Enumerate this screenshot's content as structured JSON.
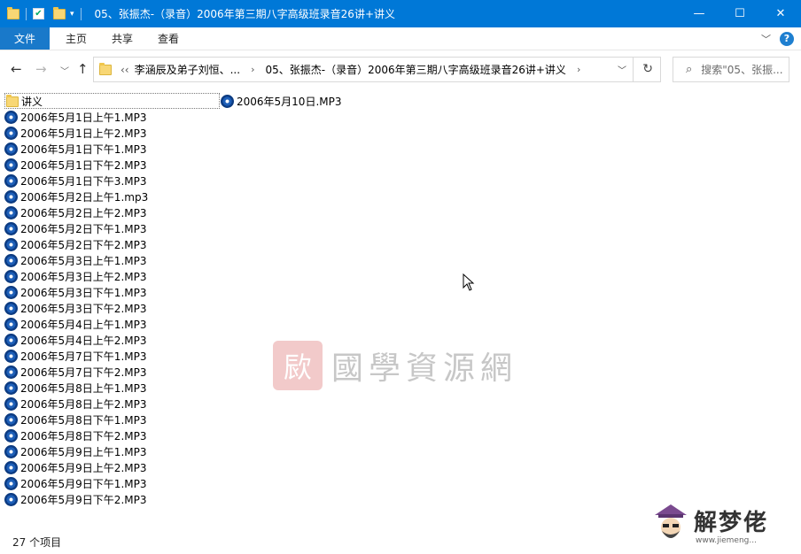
{
  "window": {
    "title": "05、张振杰-（录音）2006年第三期八字高级班录音26讲+讲义",
    "controls": {
      "minimize": "—",
      "maximize": "☐",
      "close": "✕"
    }
  },
  "ribbon": {
    "tabs": [
      "文件",
      "主页",
      "共享",
      "查看"
    ],
    "help": "?"
  },
  "address_bar": {
    "overflow": "‹‹",
    "crumbs": [
      "李涵辰及弟子刘恒、...",
      "05、张振杰-（录音）2006年第三期八字高级班录音26讲+讲义"
    ],
    "separator": "›"
  },
  "search": {
    "placeholder": "搜索\"05、张振..."
  },
  "files": [
    {
      "name": "讲义",
      "type": "folder"
    },
    {
      "name": "2006年5月10日.MP3",
      "type": "mp3"
    },
    {
      "name": "2006年5月1日上午1.MP3",
      "type": "mp3"
    },
    {
      "name": "2006年5月1日上午2.MP3",
      "type": "mp3"
    },
    {
      "name": "2006年5月1日下午1.MP3",
      "type": "mp3"
    },
    {
      "name": "2006年5月1日下午2.MP3",
      "type": "mp3"
    },
    {
      "name": "2006年5月1日下午3.MP3",
      "type": "mp3"
    },
    {
      "name": "2006年5月2日上午1.mp3",
      "type": "mp3"
    },
    {
      "name": "2006年5月2日上午2.MP3",
      "type": "mp3"
    },
    {
      "name": "2006年5月2日下午1.MP3",
      "type": "mp3"
    },
    {
      "name": "2006年5月2日下午2.MP3",
      "type": "mp3"
    },
    {
      "name": "2006年5月3日上午1.MP3",
      "type": "mp3"
    },
    {
      "name": "2006年5月3日上午2.MP3",
      "type": "mp3"
    },
    {
      "name": "2006年5月3日下午1.MP3",
      "type": "mp3"
    },
    {
      "name": "2006年5月3日下午2.MP3",
      "type": "mp3"
    },
    {
      "name": "2006年5月4日上午1.MP3",
      "type": "mp3"
    },
    {
      "name": "2006年5月4日上午2.MP3",
      "type": "mp3"
    },
    {
      "name": "2006年5月7日下午1.MP3",
      "type": "mp3"
    },
    {
      "name": "2006年5月7日下午2.MP3",
      "type": "mp3"
    },
    {
      "name": "2006年5月8日上午1.MP3",
      "type": "mp3"
    },
    {
      "name": "2006年5月8日上午2.MP3",
      "type": "mp3"
    },
    {
      "name": "2006年5月8日下午1.MP3",
      "type": "mp3"
    },
    {
      "name": "2006年5月8日下午2.MP3",
      "type": "mp3"
    },
    {
      "name": "2006年5月9日上午1.MP3",
      "type": "mp3"
    },
    {
      "name": "2006年5月9日上午2.MP3",
      "type": "mp3"
    },
    {
      "name": "2006年5月9日下午1.MP3",
      "type": "mp3"
    },
    {
      "name": "2006年5月9日下午2.MP3",
      "type": "mp3"
    }
  ],
  "status": {
    "item_count": "27 个项目"
  },
  "watermark": {
    "seal": "㰮",
    "text": "國學資源網"
  },
  "corner_logo": {
    "text": "解梦佬",
    "url": "www.jiemeng..."
  },
  "colors": {
    "titlebar": "#0078d7",
    "file_tab": "#1979ca",
    "folder": "#f8d775"
  }
}
